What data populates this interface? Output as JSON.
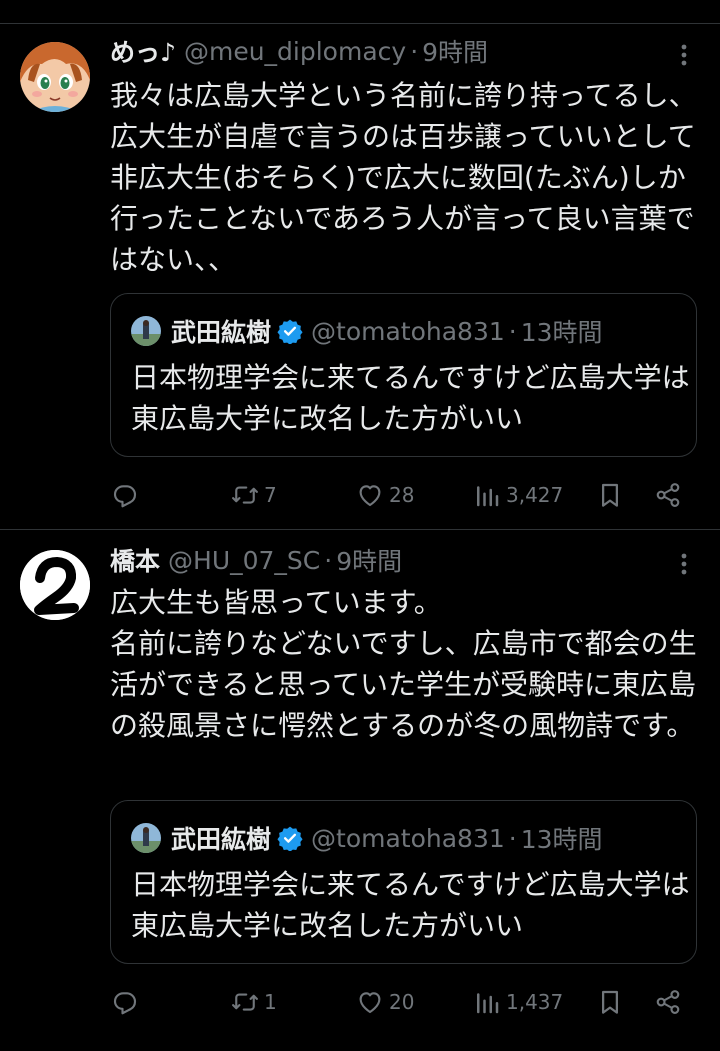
{
  "tweets": [
    {
      "display_name": "めっ♪",
      "handle": "@meu_diplomacy",
      "separator": "·",
      "time": "9時間",
      "text": "我々は広島大学という名前に誇り持ってるし、広大生が自虐で言うのは百歩譲っていいとして非広大生(おそらく)で広大に数回(たぶん)しか行ったことないであろう人が言って良い言葉ではない、、",
      "quote": {
        "display_name": "武田紘樹",
        "handle": "@tomatoha831",
        "separator": "·",
        "time": "13時間",
        "text": "日本物理学会に来てるんですけど広島大学は東広島大学に改名した方がいい"
      },
      "actions": {
        "reply_count": "",
        "retweet_count": "7",
        "like_count": "28",
        "view_count": "3,427"
      }
    },
    {
      "display_name": "橋本",
      "handle": "@HU_07_SC",
      "separator": "·",
      "time": "9時間",
      "text": "広大生も皆思っています。\n名前に誇りなどないですし、広島市で都会の生活ができると思っていた学生が受験時に東広島の殺風景さに愕然とするのが冬の風物詩です。",
      "quote": {
        "display_name": "武田紘樹",
        "handle": "@tomatoha831",
        "separator": "·",
        "time": "13時間",
        "text": "日本物理学会に来てるんですけど広島大学は東広島大学に改名した方がいい"
      },
      "actions": {
        "reply_count": "",
        "retweet_count": "1",
        "like_count": "20",
        "view_count": "1,437"
      }
    }
  ],
  "colors": {
    "background": "#000000",
    "text_primary": "#e7e9ea",
    "text_secondary": "#71767b",
    "divider": "#2f3336",
    "verified": "#1d9bf0"
  },
  "icons": {
    "more": "more-dots-icon",
    "reply": "reply-icon",
    "retweet": "retweet-icon",
    "like": "heart-icon",
    "views": "views-icon",
    "bookmark": "bookmark-icon",
    "share": "share-icon",
    "verified": "verified-badge-icon"
  }
}
